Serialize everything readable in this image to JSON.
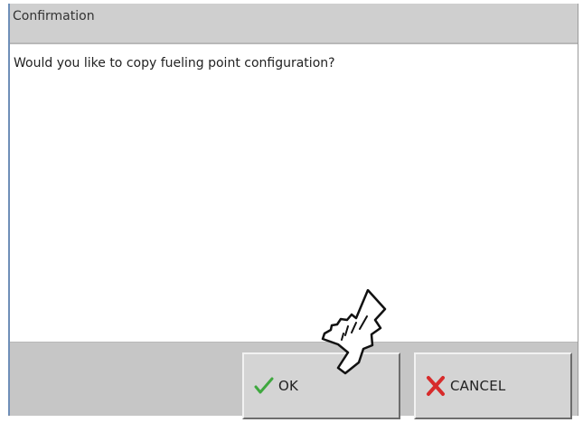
{
  "dialog": {
    "title": "Confirmation",
    "message": "Would you like to copy fueling point configuration?"
  },
  "buttons": {
    "ok": {
      "label": "OK",
      "icon": "checkmark-icon",
      "icon_color": "#3fa83f"
    },
    "cancel": {
      "label": "CANCEL",
      "icon": "x-mark-icon",
      "icon_color": "#d72b2b"
    }
  },
  "cursor": {
    "icon": "hand-pointer-icon"
  }
}
